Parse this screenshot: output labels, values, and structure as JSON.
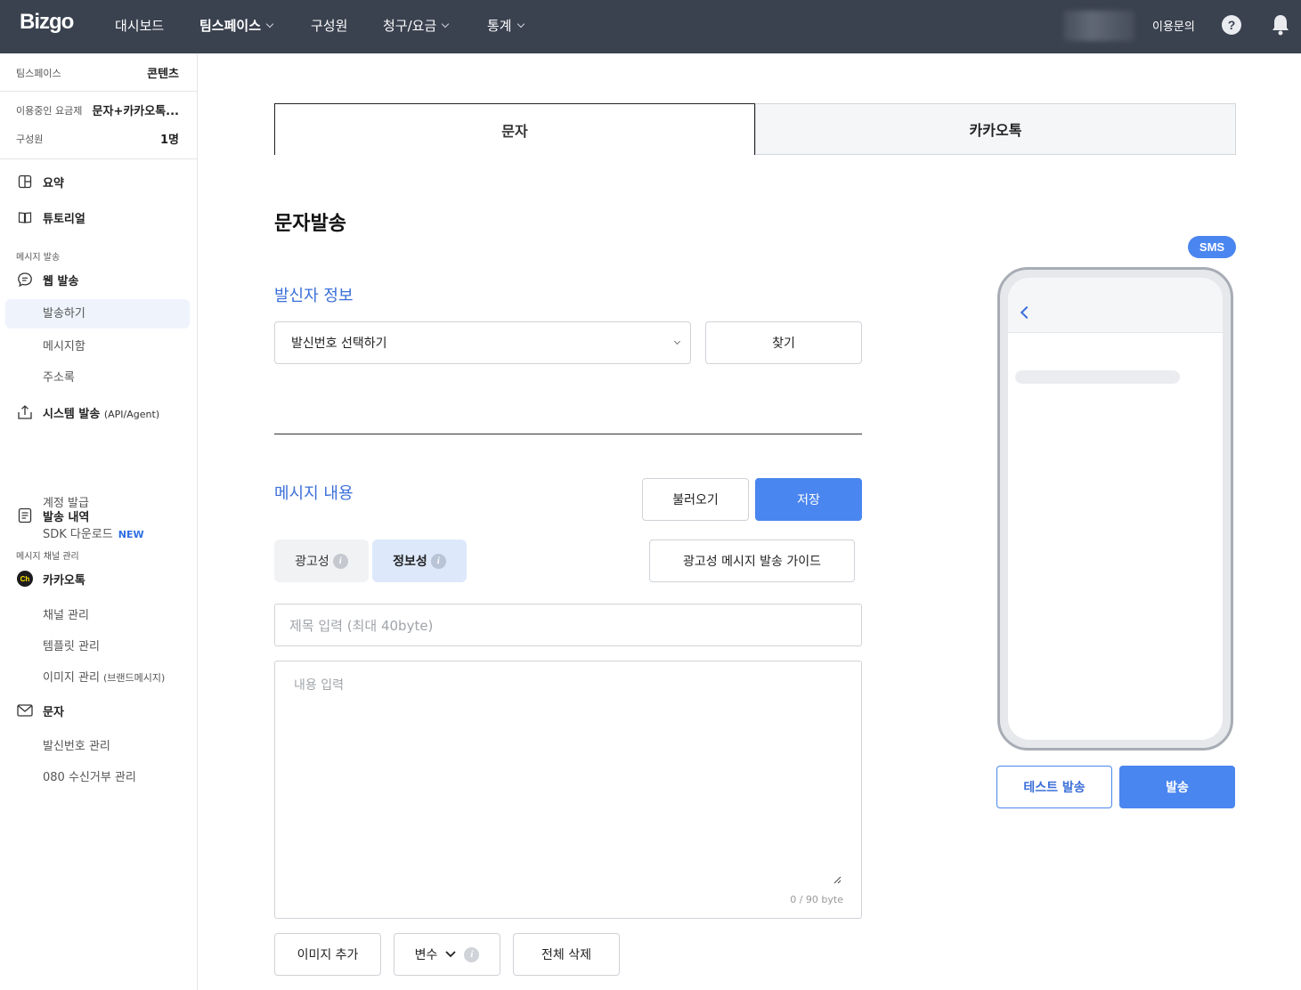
{
  "header": {
    "logo": "Bizgo",
    "nav": [
      "대시보드",
      "팀스페이스",
      "구성원",
      "청구/요금",
      "통계"
    ],
    "inquiry": "이용문의",
    "help_symbol": "?"
  },
  "sidebar": {
    "team_label": "팀스페이스",
    "team_value": "콘텐츠",
    "plan_label": "이용중인 요금제",
    "plan_value": "문자+카카오톡...",
    "members_label": "구성원",
    "members_value": "1명",
    "summary": "요약",
    "tutorial": "튜토리얼",
    "section_message": "메시지 발송",
    "web_send": "웹 발송",
    "send": "발송하기",
    "message_box": "메시지함",
    "address_book": "주소록",
    "system_send": "시스템 발송",
    "system_send_paren": "(API/Agent)",
    "account_issue": "계정 발급",
    "sdk_download": "SDK 다운로드",
    "new_badge": "NEW",
    "send_history": "발송 내역",
    "section_channel": "메시지 채널 관리",
    "kakaotalk": "카카오톡",
    "kakao_icon_text": "Ch",
    "channel_manage": "채널 관리",
    "template_manage": "템플릿 관리",
    "image_manage": "이미지 관리",
    "image_manage_paren": "(브랜드메시지)",
    "sms": "문자",
    "sender_number_manage": "발신번호 관리",
    "reject_080": "080 수신거부 관리"
  },
  "tabs": {
    "sms": "문자",
    "kakao": "카카오톡"
  },
  "main": {
    "title": "문자발송",
    "sender_info": "발신자 정보",
    "sender_select": "발신번호 선택하기",
    "find_button": "찾기",
    "message_content": "메시지 내용",
    "load_button": "불러오기",
    "save_button": "저장",
    "chip_ad": "광고성",
    "chip_info": "정보성",
    "ad_guide_button": "광고성 메시지 발송 가이드",
    "title_placeholder": "제목 입력 (최대 40byte)",
    "content_placeholder": "내용 입력",
    "byte_count": "0 / 90 byte",
    "add_image": "이미지 추가",
    "variable": "변수",
    "delete_all": "전체 삭제"
  },
  "preview": {
    "badge": "SMS",
    "test_send": "테스트 발송",
    "send": "발송"
  },
  "colors": {
    "topbar": "#3a414f",
    "accent": "#4a86ef",
    "section_blue": "#3b6fd9"
  }
}
